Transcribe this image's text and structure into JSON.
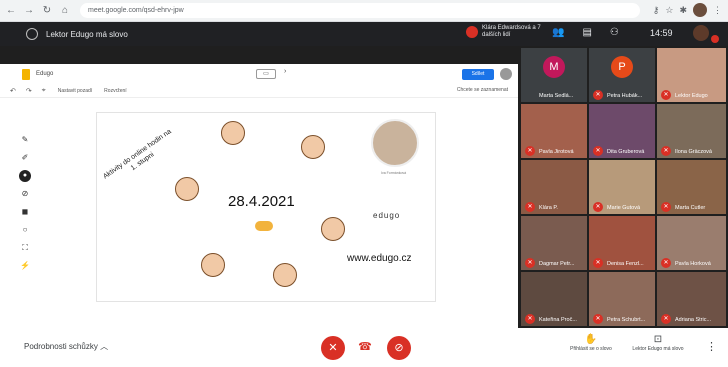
{
  "browser": {
    "url": "meet.google.com/qsd-ehrv-jpw"
  },
  "meet": {
    "title": "Lektor Edugo má slovo",
    "presenter": "Klára Edwardsová a 7 dalších lidí",
    "clock": "14:59"
  },
  "slides": {
    "doc_name": "Edugo",
    "share_label": "Sdílet",
    "toolbar_items": [
      "Nastavit pozadí",
      "Rozvržení"
    ],
    "toolbar_right": "Chcete se zaznamenat",
    "slide": {
      "rotated_text": "Aktivity do online hodin na 1. stupni",
      "date": "28.4.2021",
      "brand": "edugo",
      "url": "www.edugo.cz",
      "photo_caption": "Iva Formánková"
    }
  },
  "participants": [
    {
      "name": "Marta Sedlá...",
      "initial": "M",
      "color": "#c2185b"
    },
    {
      "name": "Petra Hubák...",
      "initial": "P",
      "color": "#e64a19"
    },
    {
      "name": "Lektor Edugo",
      "initial": "",
      "color": ""
    },
    {
      "name": "Pavla Jirotová",
      "initial": "",
      "color": ""
    },
    {
      "name": "Dita Gruberová",
      "initial": "",
      "color": ""
    },
    {
      "name": "Ilona Gräczová",
      "initial": "",
      "color": ""
    },
    {
      "name": "Klára P.",
      "initial": "",
      "color": ""
    },
    {
      "name": "Marie Gutová",
      "initial": "",
      "color": ""
    },
    {
      "name": "Marta Cutler",
      "initial": "",
      "color": ""
    },
    {
      "name": "Dagmar Petr...",
      "initial": "",
      "color": ""
    },
    {
      "name": "Denisa Fenzl...",
      "initial": "",
      "color": ""
    },
    {
      "name": "Pavla Horková",
      "initial": "",
      "color": ""
    },
    {
      "name": "Kateřina Proč...",
      "initial": "",
      "color": ""
    },
    {
      "name": "Petra Schubrt...",
      "initial": "",
      "color": ""
    },
    {
      "name": "Adriana Stric...",
      "initial": "",
      "color": ""
    }
  ],
  "bottom": {
    "details_label": "Podrobnosti schůzky",
    "raise_hand_label": "Přihlásit se o slovo",
    "presenting_label": "Lektor Edugo má slovo"
  }
}
